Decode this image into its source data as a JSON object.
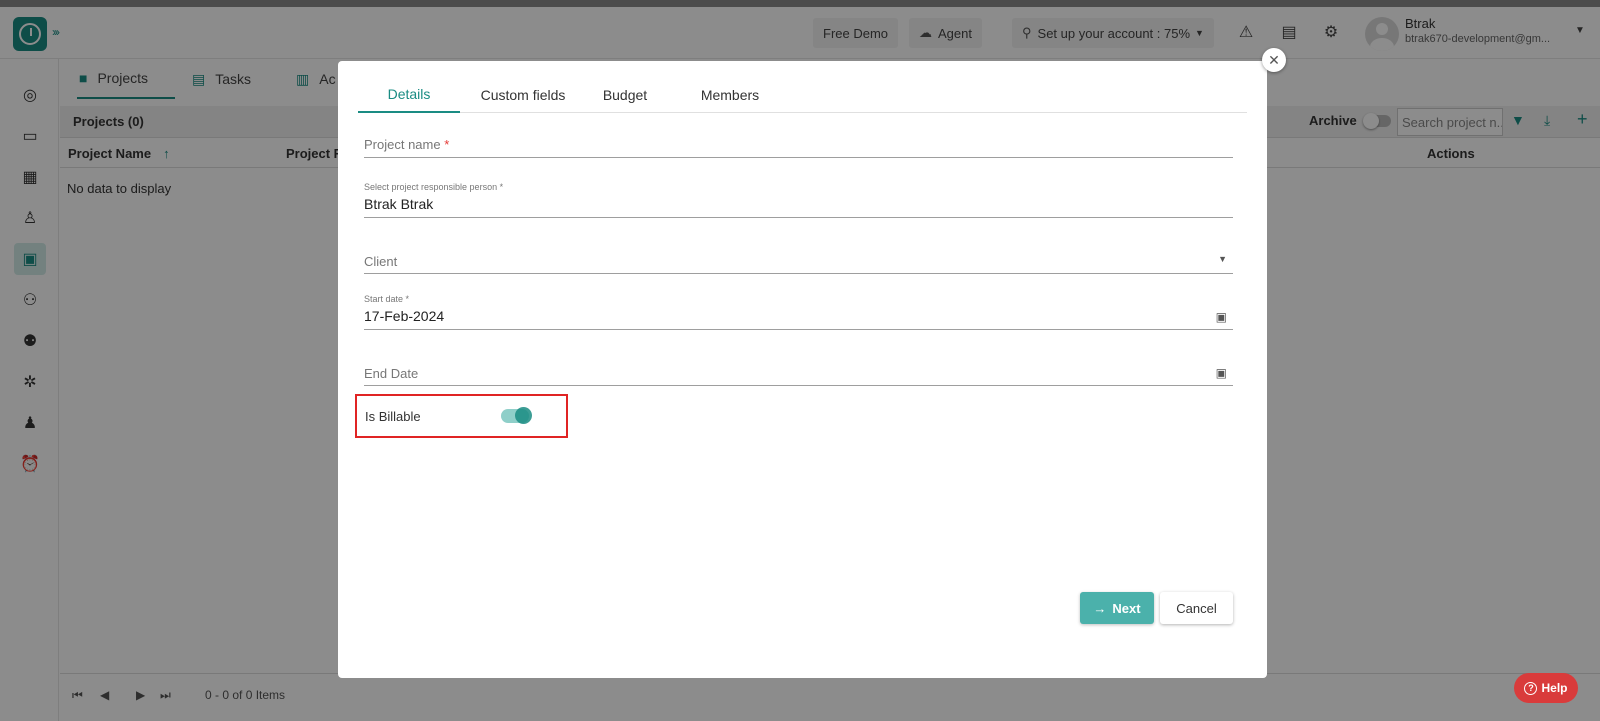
{
  "topbar": {
    "free_demo": "Free Demo",
    "agent": "Agent",
    "setup": "Set up your account : 75%",
    "user_name": "Btrak",
    "user_email": "btrak670-development@gm..."
  },
  "page_tabs": [
    "Projects",
    "Tasks",
    "Ac"
  ],
  "grid": {
    "title": "Projects (0)",
    "archive_label": "Archive",
    "search_placeholder": "Search project n...",
    "columns": [
      "Project Name",
      "Project R",
      "Actions"
    ],
    "empty_text": "No data to display",
    "pager_text": "0 - 0 of 0 Items"
  },
  "dialog": {
    "tabs": [
      "Details",
      "Custom fields",
      "Budget",
      "Members"
    ],
    "project_name_label": "Project name",
    "responsible_label": "Select project responsible person *",
    "responsible_value": "Btrak Btrak",
    "client_label": "Client",
    "start_date_label": "Start date *",
    "start_date_value": "17-Feb-2024",
    "end_date_label": "End Date",
    "billable_label": "Is Billable",
    "billable_on": true,
    "next_label": "Next",
    "cancel_label": "Cancel"
  },
  "help_label": "Help",
  "colors": {
    "accent": "#1a8c83",
    "highlight_box": "#e02424",
    "help": "#d93b3b"
  }
}
